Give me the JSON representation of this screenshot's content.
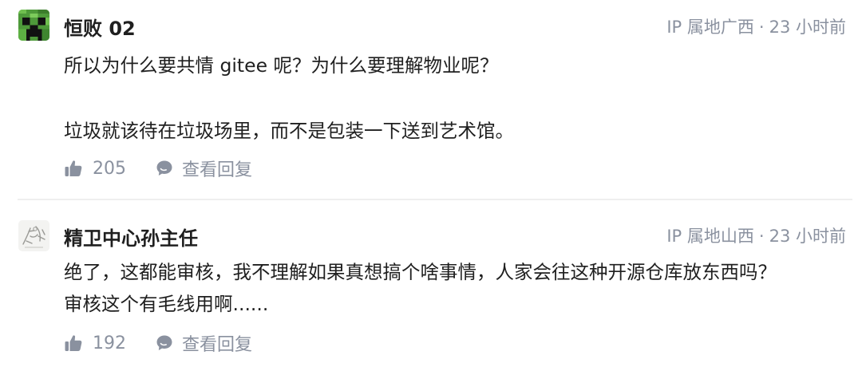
{
  "comments": [
    {
      "author": "恒败 02",
      "avatar_icon": "pixel-creeper-avatar",
      "location": "IP 属地广西",
      "separator": "·",
      "time": "23 小时前",
      "lines": [
        "所以为什么要共情 gitee 呢？为什么要理解物业呢？",
        "垃圾就该待在垃圾场里，而不是包装一下送到艺术馆。"
      ],
      "likes": "205",
      "reply_label": "查看回复"
    },
    {
      "author": "精卫中心孙主任",
      "avatar_icon": "sketch-drawing-avatar",
      "location": "IP 属地山西",
      "separator": "·",
      "time": "23 小时前",
      "lines": [
        "绝了，这都能审核，我不理解如果真想搞个啥事情，人家会往这种开源仓库放东西吗？",
        "审核这个有毛线用啊......"
      ],
      "likes": "192",
      "reply_label": "查看回复"
    }
  ],
  "icons": {
    "like": "thumbs-up-icon",
    "reply": "comment-bubble-icon"
  },
  "colors": {
    "text": "#1f1f1f",
    "muted": "#8a919f",
    "divider": "#efefef"
  }
}
